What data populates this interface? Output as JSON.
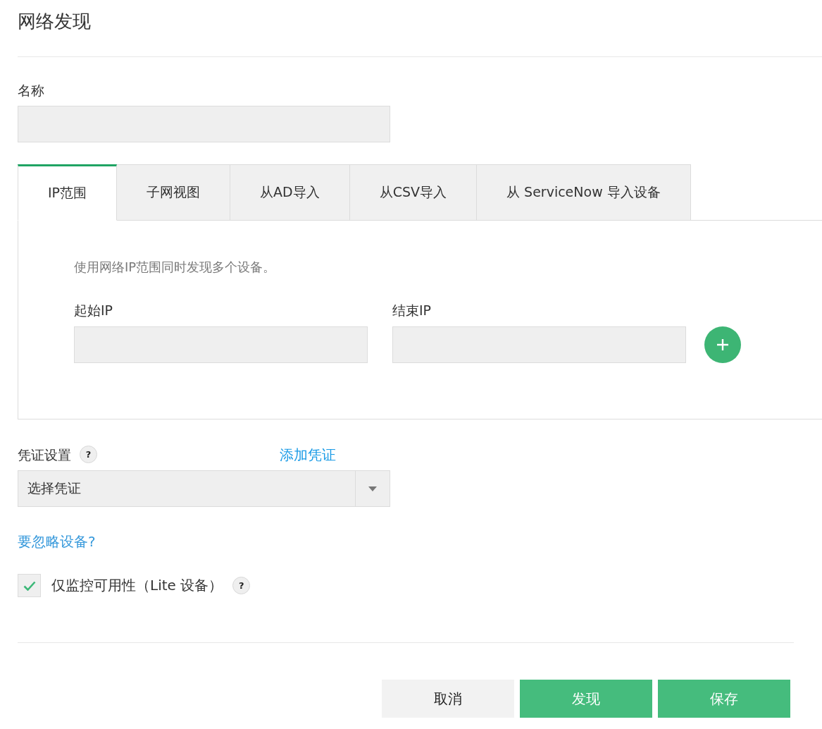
{
  "page": {
    "title": "网络发现"
  },
  "name_field": {
    "label": "名称"
  },
  "tabs": [
    {
      "label": "IP范围",
      "selected": true
    },
    {
      "label": "子网视图",
      "selected": false
    },
    {
      "label": "从AD导入",
      "selected": false
    },
    {
      "label": "从CSV导入",
      "selected": false
    },
    {
      "label": "从 ServiceNow 导入设备",
      "selected": false
    }
  ],
  "ip_range_panel": {
    "description": "使用网络IP范围同时发现多个设备。",
    "start_ip": {
      "label": "起始IP"
    },
    "end_ip": {
      "label": "结束IP"
    }
  },
  "credentials": {
    "label": "凭证设置",
    "help": "?",
    "add_link": "添加凭证",
    "select": {
      "value": "选择凭证"
    }
  },
  "ignore_link": "要忽略设备?",
  "availability_only": {
    "label": "仅监控可用性（Lite 设备）",
    "help": "?",
    "checked": true
  },
  "buttons": [
    {
      "label": "取消",
      "kind": "secondary"
    },
    {
      "label": "发现",
      "kind": "primary"
    },
    {
      "label": "保存",
      "kind": "primary"
    }
  ]
}
